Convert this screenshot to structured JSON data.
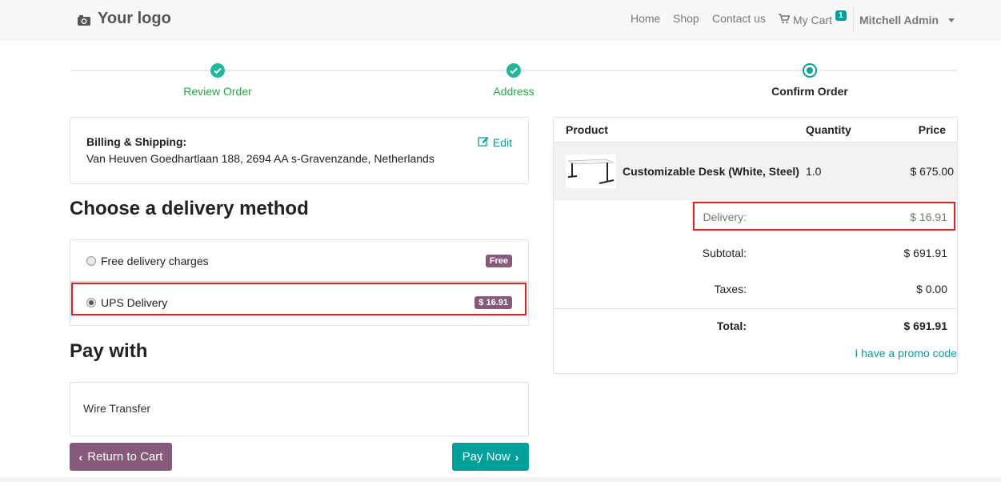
{
  "header": {
    "logo_text": "Your logo",
    "nav": {
      "home": "Home",
      "shop": "Shop",
      "contact": "Contact us",
      "cart": "My Cart",
      "cart_count": "1",
      "user": "Mitchell Admin"
    }
  },
  "progress": {
    "steps": [
      {
        "label": "Review Order",
        "state": "done"
      },
      {
        "label": "Address",
        "state": "done"
      },
      {
        "label": "Confirm Order",
        "state": "current"
      }
    ]
  },
  "billing": {
    "title": "Billing & Shipping:",
    "address": "Van Heuven Goedhartlaan 188, 2694 AA s-Gravenzande, Netherlands",
    "edit_label": "Edit"
  },
  "delivery": {
    "title": "Choose a delivery method",
    "options": [
      {
        "label": "Free delivery charges",
        "badge": "Free",
        "selected": false
      },
      {
        "label": "UPS Delivery",
        "badge": "$ 16.91",
        "selected": true
      }
    ]
  },
  "payment": {
    "title": "Pay with",
    "method": "Wire Transfer"
  },
  "buttons": {
    "return_cart": "Return to Cart",
    "pay_now": "Pay Now"
  },
  "summary": {
    "headers": {
      "product": "Product",
      "quantity": "Quantity",
      "price": "Price"
    },
    "item": {
      "name": "Customizable Desk (White, Steel)",
      "quantity": "1.0",
      "price": "$ 675.00"
    },
    "delivery": {
      "label": "Delivery:",
      "value": "$ 16.91"
    },
    "subtotal": {
      "label": "Subtotal:",
      "value": "$ 691.91"
    },
    "taxes": {
      "label": "Taxes:",
      "value": "$ 0.00"
    },
    "total": {
      "label": "Total:",
      "value": "$ 691.91"
    },
    "promo": "I have a promo code"
  },
  "colors": {
    "primary": "#00a09d",
    "secondary": "#875a7b",
    "success": "#21b799",
    "highlight": "#d9262b"
  }
}
